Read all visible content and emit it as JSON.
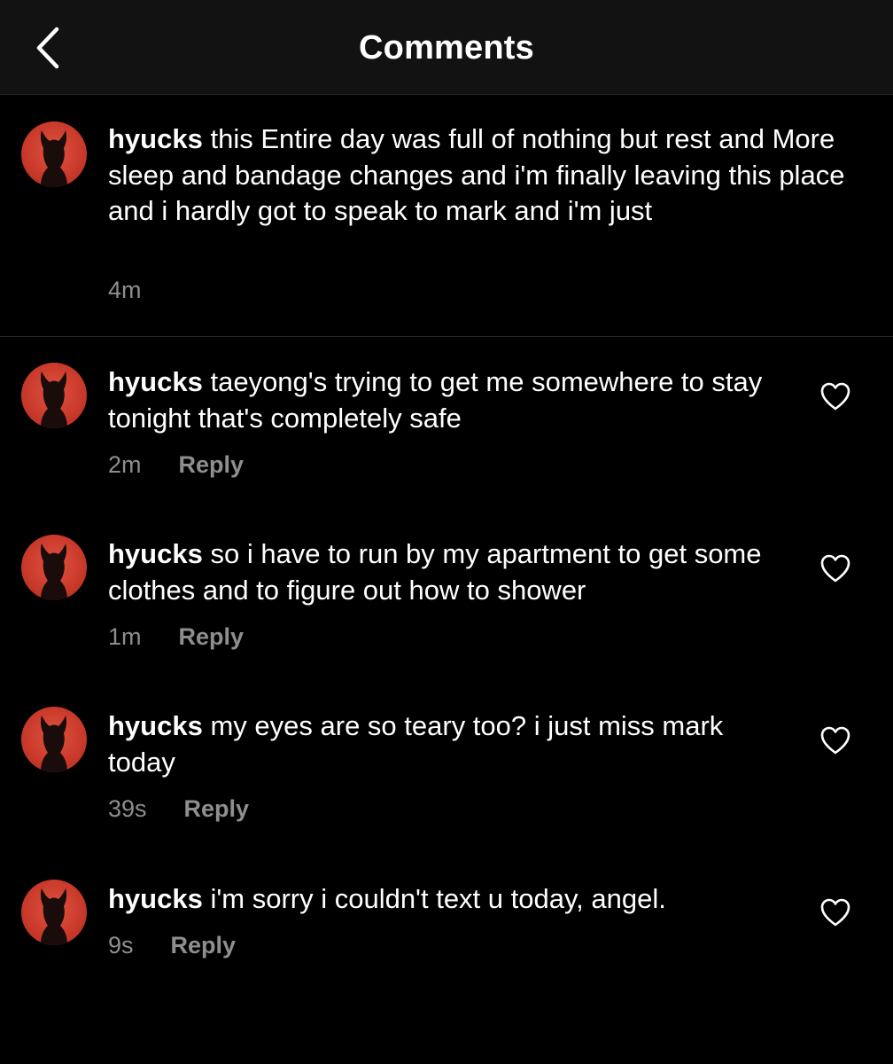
{
  "header": {
    "title": "Comments"
  },
  "caption": {
    "username": "hyucks",
    "text": "this Entire day was full of nothing but rest and More sleep and bandage changes and i'm finally leaving this place and i hardly got to speak to mark and i'm just",
    "time": "4m"
  },
  "comments": [
    {
      "username": "hyucks",
      "text": "taeyong's trying to get me somewhere to stay tonight that's completely safe",
      "time": "2m",
      "reply_label": "Reply"
    },
    {
      "username": "hyucks",
      "text": "so i have to run by my apartment to get some clothes and to figure out how to shower",
      "time": "1m",
      "reply_label": "Reply"
    },
    {
      "username": "hyucks",
      "text": "my eyes are so teary too? i just miss mark today",
      "time": "39s",
      "reply_label": "Reply"
    },
    {
      "username": "hyucks",
      "text": "i'm sorry i couldn't text u today, angel.",
      "time": "9s",
      "reply_label": "Reply"
    }
  ],
  "colors": {
    "background": "#000000",
    "header_background": "#121212",
    "secondary_text": "#8e8e8e",
    "avatar_red": "#d0412f"
  },
  "icons": {
    "back": "chevron-left-icon",
    "like": "heart-outline-icon",
    "avatar": "devil-silhouette-avatar"
  }
}
